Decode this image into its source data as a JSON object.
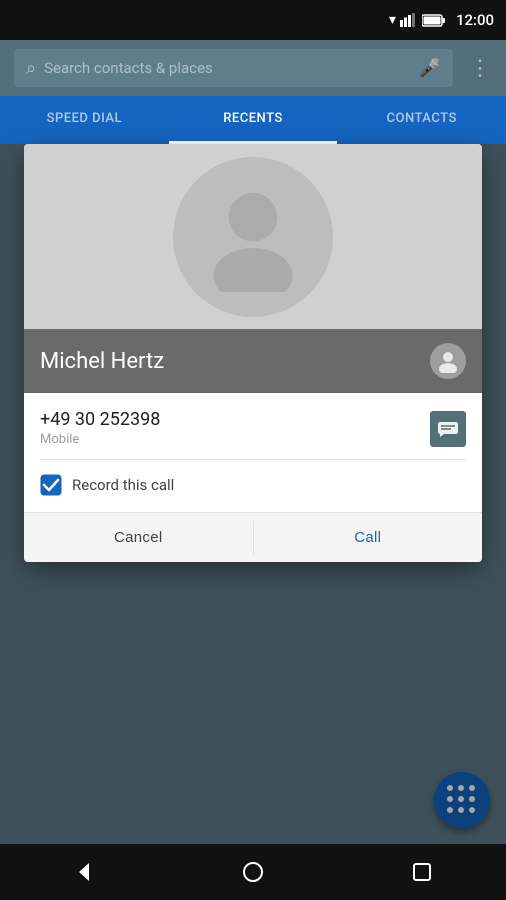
{
  "statusBar": {
    "time": "12:00"
  },
  "searchBar": {
    "placeholder": "Search contacts & places"
  },
  "tabs": [
    {
      "label": "SPEED DIAL",
      "active": false
    },
    {
      "label": "RECENTS",
      "active": true
    },
    {
      "label": "CONTACTS",
      "active": false
    }
  ],
  "fab": {
    "ariaLabel": "Dialpad"
  },
  "navBar": {
    "back": "◁",
    "home": "○",
    "recents": "□"
  },
  "dialog": {
    "contactName": "Michel Hertz",
    "phoneNumber": "+49 30 252398",
    "phoneType": "Mobile",
    "recordLabel": "Record this call",
    "cancelLabel": "Cancel",
    "callLabel": "Call"
  }
}
